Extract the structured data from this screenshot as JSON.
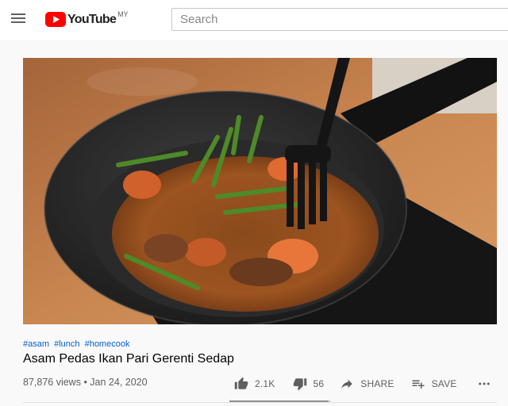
{
  "header": {
    "logo_text": "YouTube",
    "region": "MY",
    "brand_color": "#ff0000",
    "search_placeholder": "Search"
  },
  "video": {
    "hashtags": [
      "#asam",
      "#lunch",
      "#homecook"
    ],
    "title": "Asam Pedas Ikan Pari Gerenti Sedap",
    "views": "87,876 views",
    "date": "Jan 24, 2020",
    "meta_separator": " • "
  },
  "actions": {
    "like_count": "2.1K",
    "dislike_count": "56",
    "share_label": "SHARE",
    "save_label": "SAVE",
    "like_ratio": 0.974
  },
  "icons": [
    "menu-icon",
    "youtube-logo-icon",
    "thumbs-up-icon",
    "thumbs-down-icon",
    "share-icon",
    "playlist-add-icon",
    "more-icon"
  ]
}
